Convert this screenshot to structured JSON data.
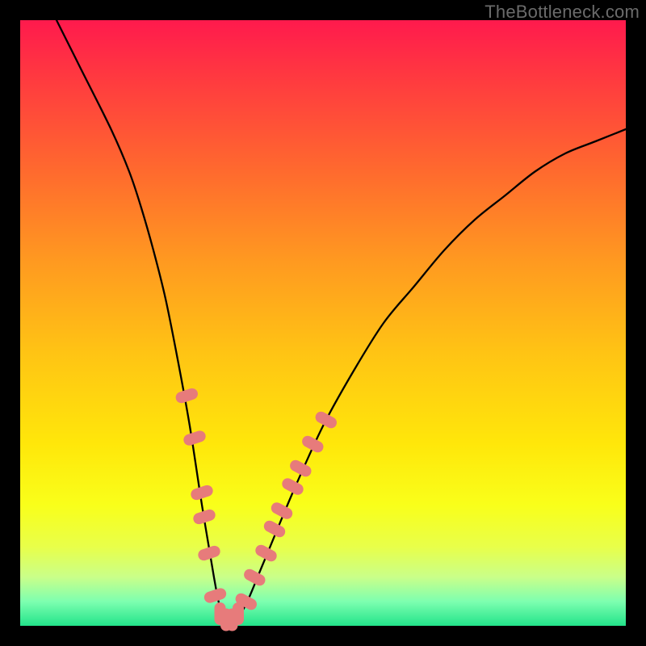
{
  "watermark": "TheBottleneck.com",
  "chart_data": {
    "type": "line",
    "title": "",
    "xlabel": "",
    "ylabel": "",
    "xlim": [
      0,
      100
    ],
    "ylim": [
      0,
      100
    ],
    "series": [
      {
        "name": "bottleneck-curve",
        "x": [
          6,
          10,
          15,
          18,
          20,
          22,
          24,
          26,
          28,
          30,
          32,
          33,
          34,
          35,
          37,
          40,
          45,
          50,
          55,
          60,
          65,
          70,
          75,
          80,
          85,
          90,
          95,
          100
        ],
        "y": [
          100,
          92,
          82,
          75,
          69,
          62,
          54,
          44,
          33,
          20,
          8,
          3,
          1,
          1,
          3,
          10,
          22,
          33,
          42,
          50,
          56,
          62,
          67,
          71,
          75,
          78,
          80,
          82
        ]
      }
    ],
    "markers": {
      "name": "highlight-beads",
      "color": "#e77b7b",
      "points": [
        {
          "x": 27.5,
          "y": 38
        },
        {
          "x": 28.8,
          "y": 31
        },
        {
          "x": 30.0,
          "y": 22
        },
        {
          "x": 30.4,
          "y": 18
        },
        {
          "x": 31.2,
          "y": 12
        },
        {
          "x": 32.2,
          "y": 5
        },
        {
          "x": 33.0,
          "y": 2
        },
        {
          "x": 34.0,
          "y": 1
        },
        {
          "x": 35.0,
          "y": 1
        },
        {
          "x": 36.0,
          "y": 2
        },
        {
          "x": 37.3,
          "y": 4
        },
        {
          "x": 38.7,
          "y": 8
        },
        {
          "x": 40.6,
          "y": 12
        },
        {
          "x": 42.0,
          "y": 16
        },
        {
          "x": 43.2,
          "y": 19
        },
        {
          "x": 45.0,
          "y": 23
        },
        {
          "x": 46.3,
          "y": 26
        },
        {
          "x": 48.3,
          "y": 30
        },
        {
          "x": 50.5,
          "y": 34
        }
      ]
    },
    "background_gradient": {
      "top": "#ff1a4d",
      "bottom": "#22e38a"
    }
  }
}
